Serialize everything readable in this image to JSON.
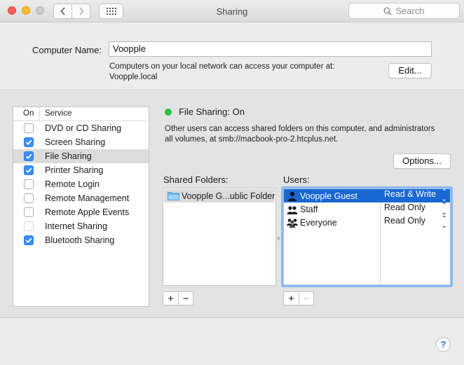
{
  "window": {
    "title": "Sharing"
  },
  "search": {
    "placeholder": "Search"
  },
  "computer": {
    "label": "Computer Name:",
    "value": "Voopple",
    "description_line1": "Computers on your local network can access your computer at:",
    "description_line2": "Voopple.local",
    "edit_label": "Edit..."
  },
  "services": {
    "header_on": "On",
    "header_service": "Service",
    "items": [
      {
        "label": "DVD or CD Sharing",
        "checked": false,
        "selected": false,
        "disabled": false
      },
      {
        "label": "Screen Sharing",
        "checked": true,
        "selected": false,
        "disabled": false
      },
      {
        "label": "File Sharing",
        "checked": true,
        "selected": true,
        "disabled": false
      },
      {
        "label": "Printer Sharing",
        "checked": true,
        "selected": false,
        "disabled": false
      },
      {
        "label": "Remote Login",
        "checked": false,
        "selected": false,
        "disabled": false
      },
      {
        "label": "Remote Management",
        "checked": false,
        "selected": false,
        "disabled": false
      },
      {
        "label": "Remote Apple Events",
        "checked": false,
        "selected": false,
        "disabled": false
      },
      {
        "label": "Internet Sharing",
        "checked": false,
        "selected": false,
        "disabled": true
      },
      {
        "label": "Bluetooth Sharing",
        "checked": true,
        "selected": false,
        "disabled": false
      }
    ]
  },
  "file_sharing": {
    "status": "File Sharing: On",
    "status_color": "#2bbf46",
    "description_line1": "Other users can access shared folders on this computer, and administrators",
    "description_line2": "all volumes, at smb://macbook-pro-2.htcplus.net.",
    "options_label": "Options...",
    "shared_folders_label": "Shared Folders:",
    "users_label": "Users:",
    "shared_folders": [
      {
        "name": "Voopple G...ublic Folder"
      }
    ],
    "users": [
      {
        "name": "Voopple Guest",
        "permission": "Read & Write",
        "icon": "single-user-icon",
        "selected": true
      },
      {
        "name": "Staff",
        "permission": "Read Only",
        "icon": "group-icon",
        "selected": false
      },
      {
        "name": "Everyone",
        "permission": "Read Only",
        "icon": "everyone-icon",
        "selected": false
      }
    ],
    "add_label": "+",
    "remove_label": "−"
  },
  "help_label": "?",
  "accent_color": "#1967d2"
}
